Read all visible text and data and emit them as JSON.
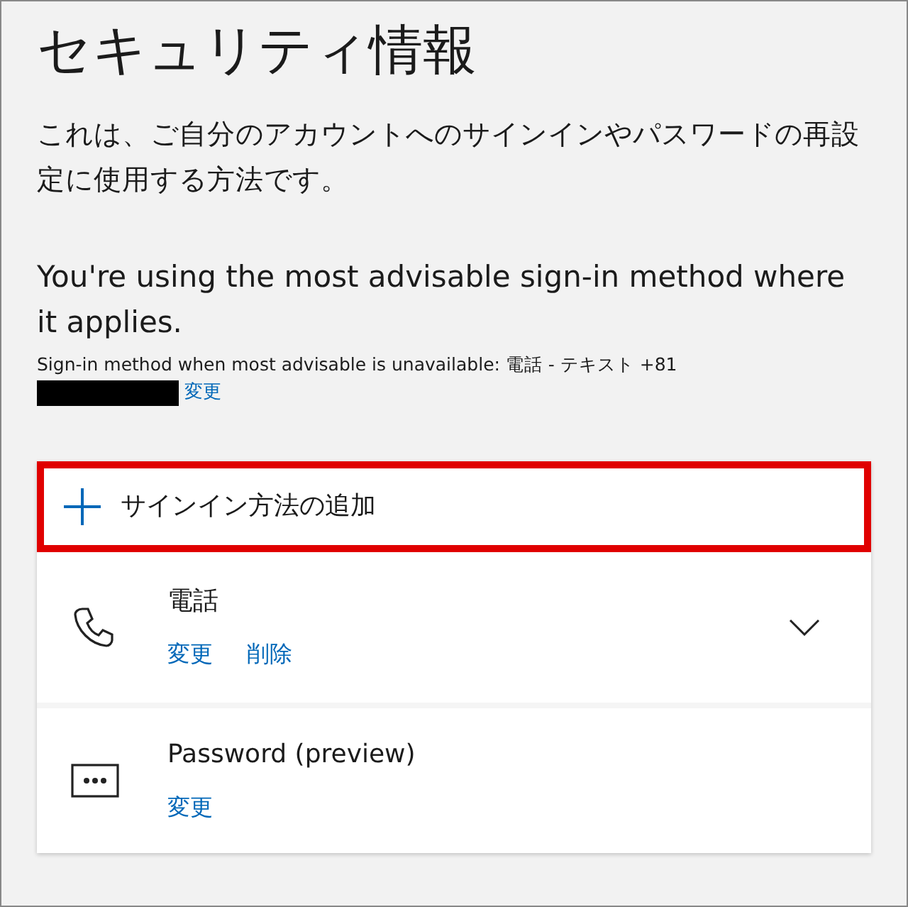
{
  "title": "セキュリティ情報",
  "description": "これは、ご自分のアカウントへのサインインやパスワードの再設定に使用する方法です。",
  "advisory": {
    "heading": "You're using the most advisable sign-in method where it applies.",
    "fallback": "Sign-in method when most advisable is unavailable: 電話 - テキスト +81",
    "link": "変更"
  },
  "add_method": {
    "label": "サインイン方法の追加",
    "highlighted": true
  },
  "methods": [
    {
      "kind": "phone",
      "name": "電話",
      "expandable": true,
      "actions": [
        "変更",
        "削除"
      ]
    },
    {
      "kind": "password",
      "name": "Password (preview)",
      "expandable": false,
      "actions": [
        "変更"
      ]
    }
  ]
}
